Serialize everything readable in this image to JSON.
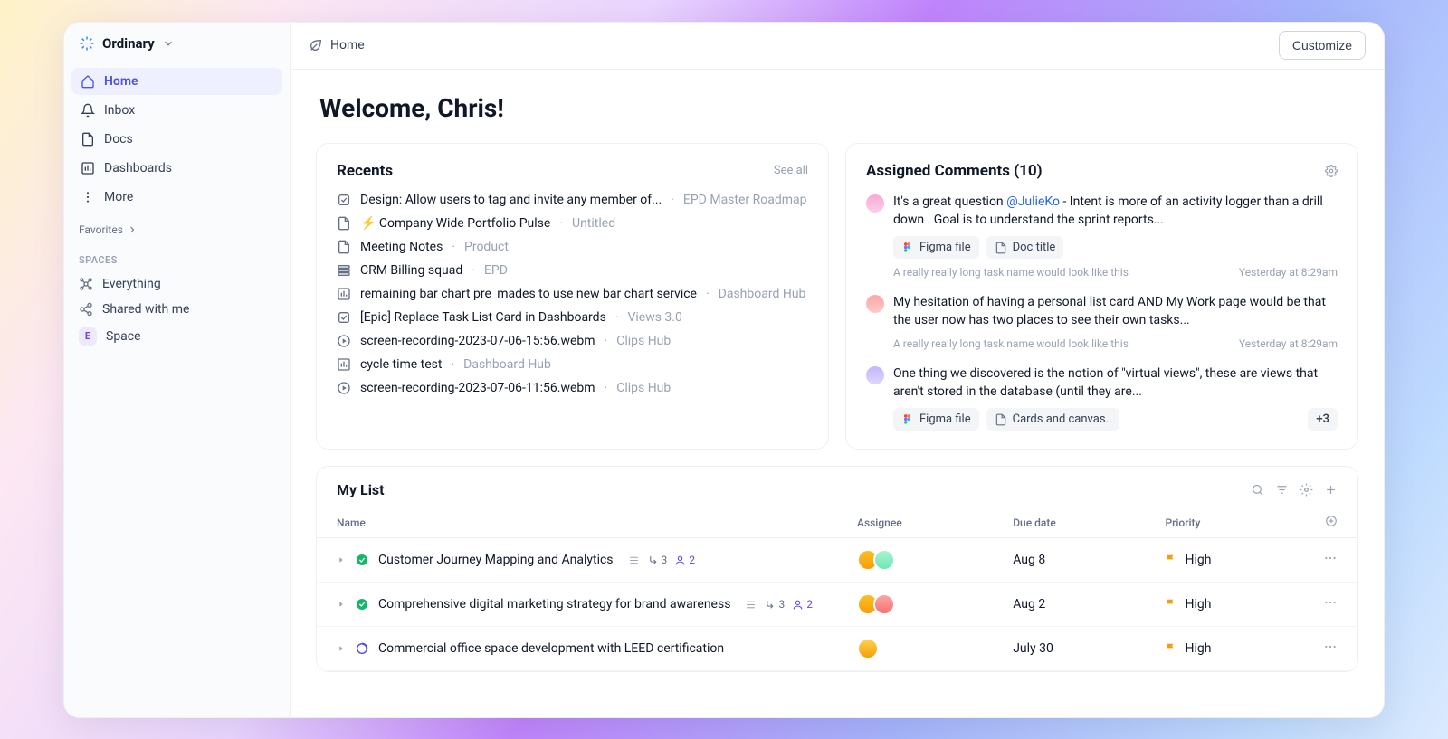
{
  "workspace": {
    "name": "Ordinary"
  },
  "nav": {
    "items": [
      {
        "label": "Home",
        "active": true
      },
      {
        "label": "Inbox"
      },
      {
        "label": "Docs"
      },
      {
        "label": "Dashboards"
      },
      {
        "label": "More"
      }
    ],
    "favorites_label": "Favorites",
    "spaces_label": "SPACES",
    "spaces": [
      {
        "label": "Everything"
      },
      {
        "label": "Shared with me"
      },
      {
        "label": "Space",
        "badge": "E"
      }
    ]
  },
  "breadcrumb": {
    "title": "Home"
  },
  "actions": {
    "customize": "Customize"
  },
  "welcome": "Welcome, Chris!",
  "recents": {
    "title": "Recents",
    "see_all": "See all",
    "items": [
      {
        "icon": "task",
        "title": "Design: Allow users to tag and invite any member of...",
        "loc": "EPD Master Roadmap"
      },
      {
        "icon": "doc",
        "title": "⚡ Company Wide Portfolio Pulse",
        "loc": "Untitled"
      },
      {
        "icon": "doc",
        "title": "Meeting Notes",
        "loc": "Product"
      },
      {
        "icon": "list",
        "title": "CRM Billing squad",
        "loc": "EPD"
      },
      {
        "icon": "dash",
        "title": "remaining bar chart pre_mades to use new bar chart service",
        "loc": "Dashboard Hub"
      },
      {
        "icon": "task",
        "title": "[Epic] Replace Task List Card in Dashboards",
        "loc": "Views 3.0"
      },
      {
        "icon": "clip",
        "title": "screen-recording-2023-07-06-15:56.webm",
        "loc": "Clips Hub"
      },
      {
        "icon": "dash",
        "title": "cycle time test",
        "loc": "Dashboard Hub"
      },
      {
        "icon": "clip",
        "title": "screen-recording-2023-07-06-11:56.webm",
        "loc": "Clips Hub"
      }
    ]
  },
  "comments": {
    "title": "Assigned Comments (10)",
    "items": [
      {
        "avatar": "a",
        "text_pre": "It's a great question ",
        "mention": "@JulieKo",
        "text_post": " - Intent is  more of an activity logger than a drill down . Goal is to understand the sprint reports...",
        "chips": [
          {
            "kind": "figma",
            "label": "Figma file"
          },
          {
            "kind": "doc",
            "label": "Doc title"
          }
        ],
        "meta_task": "A really really long task name would look like this",
        "meta_time": "Yesterday at 8:29am"
      },
      {
        "avatar": "b",
        "text_pre": "My hesitation of having a personal list card AND My Work page would be that the user now has two places to see their own tasks...",
        "mention": "",
        "text_post": "",
        "chips": [],
        "meta_task": "A really really long task name would look like this",
        "meta_time": "Yesterday at 8:29am"
      },
      {
        "avatar": "c",
        "text_pre": "One thing we discovered is the notion of \"virtual views\", these are views that aren't stored in the database (until they are...",
        "mention": "",
        "text_post": "",
        "chips": [
          {
            "kind": "figma",
            "label": "Figma file"
          },
          {
            "kind": "doc",
            "label": "Cards and canvas.."
          }
        ],
        "extra_count": "+3",
        "meta_task": "",
        "meta_time": ""
      }
    ]
  },
  "mylist": {
    "title": "My List",
    "columns": {
      "name": "Name",
      "assignee": "Assignee",
      "due": "Due date",
      "priority": "Priority"
    },
    "rows": [
      {
        "status": "done",
        "name": "Customer Journey Mapping and Analytics",
        "sub": "3",
        "att": "2",
        "assignees": [
          "a1",
          "a2"
        ],
        "due": "Aug 8",
        "prio": "High"
      },
      {
        "status": "done",
        "name": "Comprehensive digital marketing strategy for brand awareness",
        "sub": "3",
        "att": "2",
        "assignees": [
          "a1",
          "a3"
        ],
        "due": "Aug 2",
        "prio": "High"
      },
      {
        "status": "progress",
        "name": "Commercial office space development with LEED certification",
        "sub": "",
        "att": "",
        "assignees": [
          "a5"
        ],
        "due": "July 30",
        "prio": "High"
      }
    ]
  }
}
